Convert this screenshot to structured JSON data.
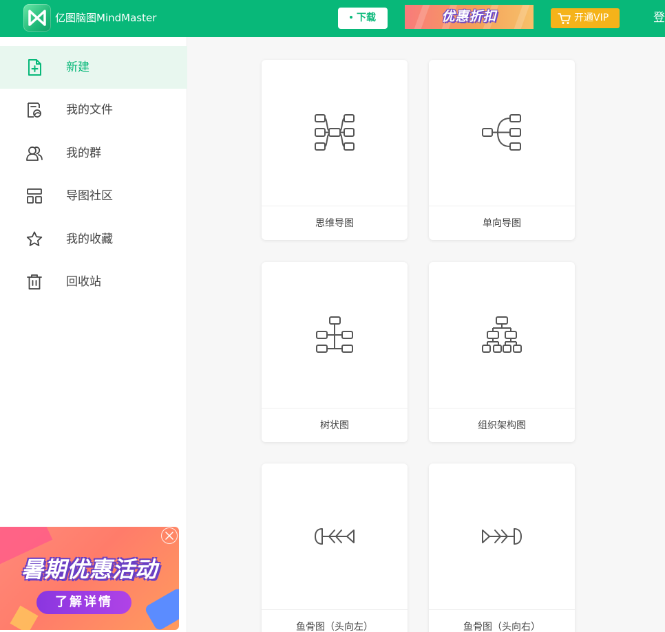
{
  "header": {
    "app_title": "亿图脑图MindMaster",
    "download_label": "下载",
    "promo_text": "优惠折扣",
    "vip_label": "开通VIP",
    "login_label": "登",
    "logo_icon": "mindmaster-logo-icon",
    "brand_color": "#08b879"
  },
  "sidebar": {
    "items": [
      {
        "label": "新建",
        "icon": "new-file-icon",
        "active": true
      },
      {
        "label": "我的文件",
        "icon": "my-files-icon",
        "active": false
      },
      {
        "label": "我的群",
        "icon": "group-icon",
        "active": false
      },
      {
        "label": "导图社区",
        "icon": "community-icon",
        "active": false
      },
      {
        "label": "我的收藏",
        "icon": "star-icon",
        "active": false
      },
      {
        "label": "回收站",
        "icon": "trash-icon",
        "active": false
      }
    ],
    "ad": {
      "title": "暑期优惠活动",
      "button_label": "了解详情"
    }
  },
  "templates": [
    {
      "label": "思维导图",
      "icon": "mind-map-icon"
    },
    {
      "label": "单向导图",
      "icon": "one-way-map-icon"
    },
    {
      "label": "树状图",
      "icon": "tree-chart-icon"
    },
    {
      "label": "组织架构图",
      "icon": "org-chart-icon"
    },
    {
      "label": "鱼骨图（头向左）",
      "icon": "fishbone-left-icon"
    },
    {
      "label": "鱼骨图（头向右）",
      "icon": "fishbone-right-icon"
    }
  ]
}
